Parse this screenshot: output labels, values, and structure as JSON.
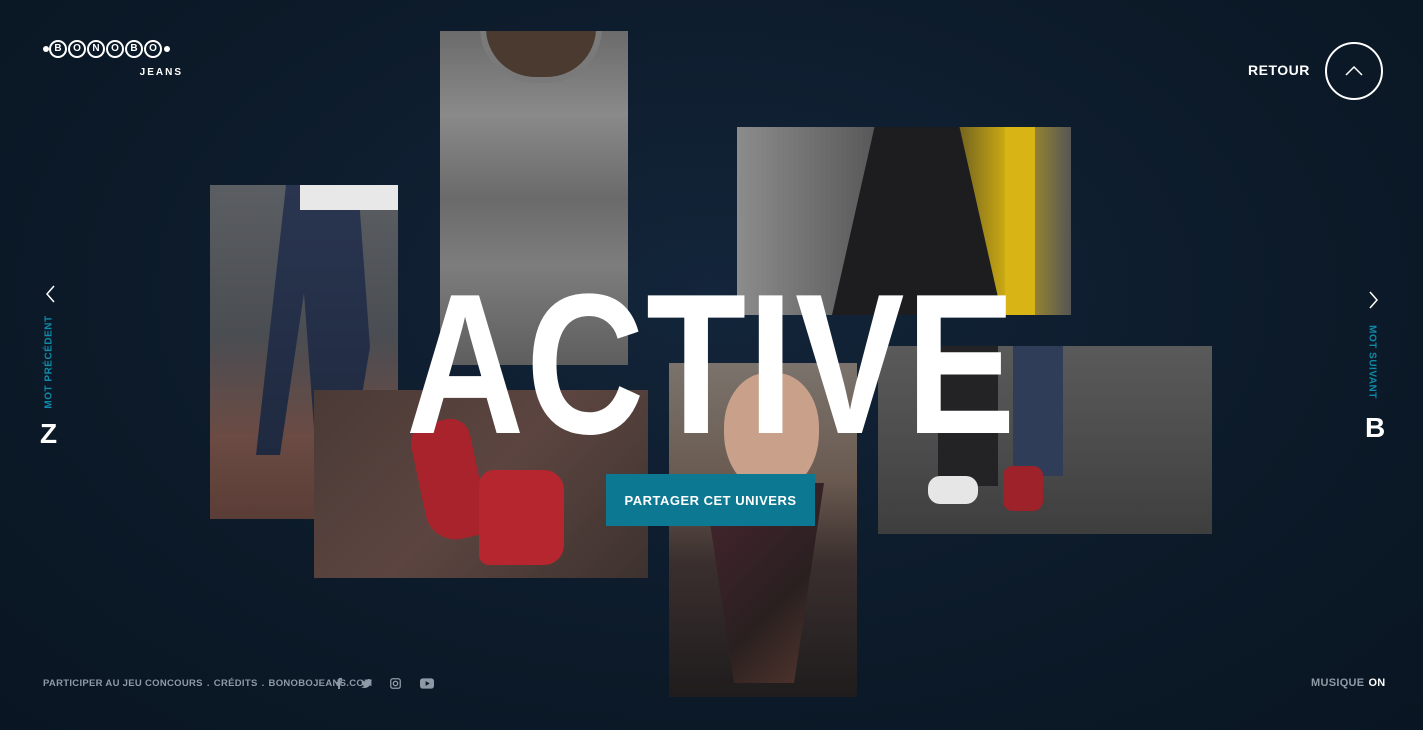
{
  "brand": {
    "logo_letters": [
      "B",
      "O",
      "N",
      "O",
      "B",
      "O"
    ],
    "logo_sub": "JEANS"
  },
  "header": {
    "retour_label": "RETOUR",
    "up_icon": "chevron-up-icon"
  },
  "main": {
    "word": "ACTIVE",
    "share_label": "PARTAGER CET UNIVERS",
    "accent_color": "#0d7892"
  },
  "nav": {
    "prev": {
      "label": "MOT PRÉCÉDENT",
      "letter": "Z",
      "icon": "chevron-left-icon"
    },
    "next": {
      "label": "MOT SUIVANT",
      "letter": "B",
      "icon": "chevron-right-icon"
    }
  },
  "footer": {
    "links": [
      "PARTICIPER AU JEU CONCOURS",
      ".",
      "CRÉDITS",
      ".",
      "BONOBOJEANS.COM"
    ],
    "social": [
      "facebook-icon",
      "twitter-icon",
      "instagram-icon",
      "youtube-icon"
    ],
    "music_label": "MUSIQUE",
    "music_state": "ON"
  }
}
